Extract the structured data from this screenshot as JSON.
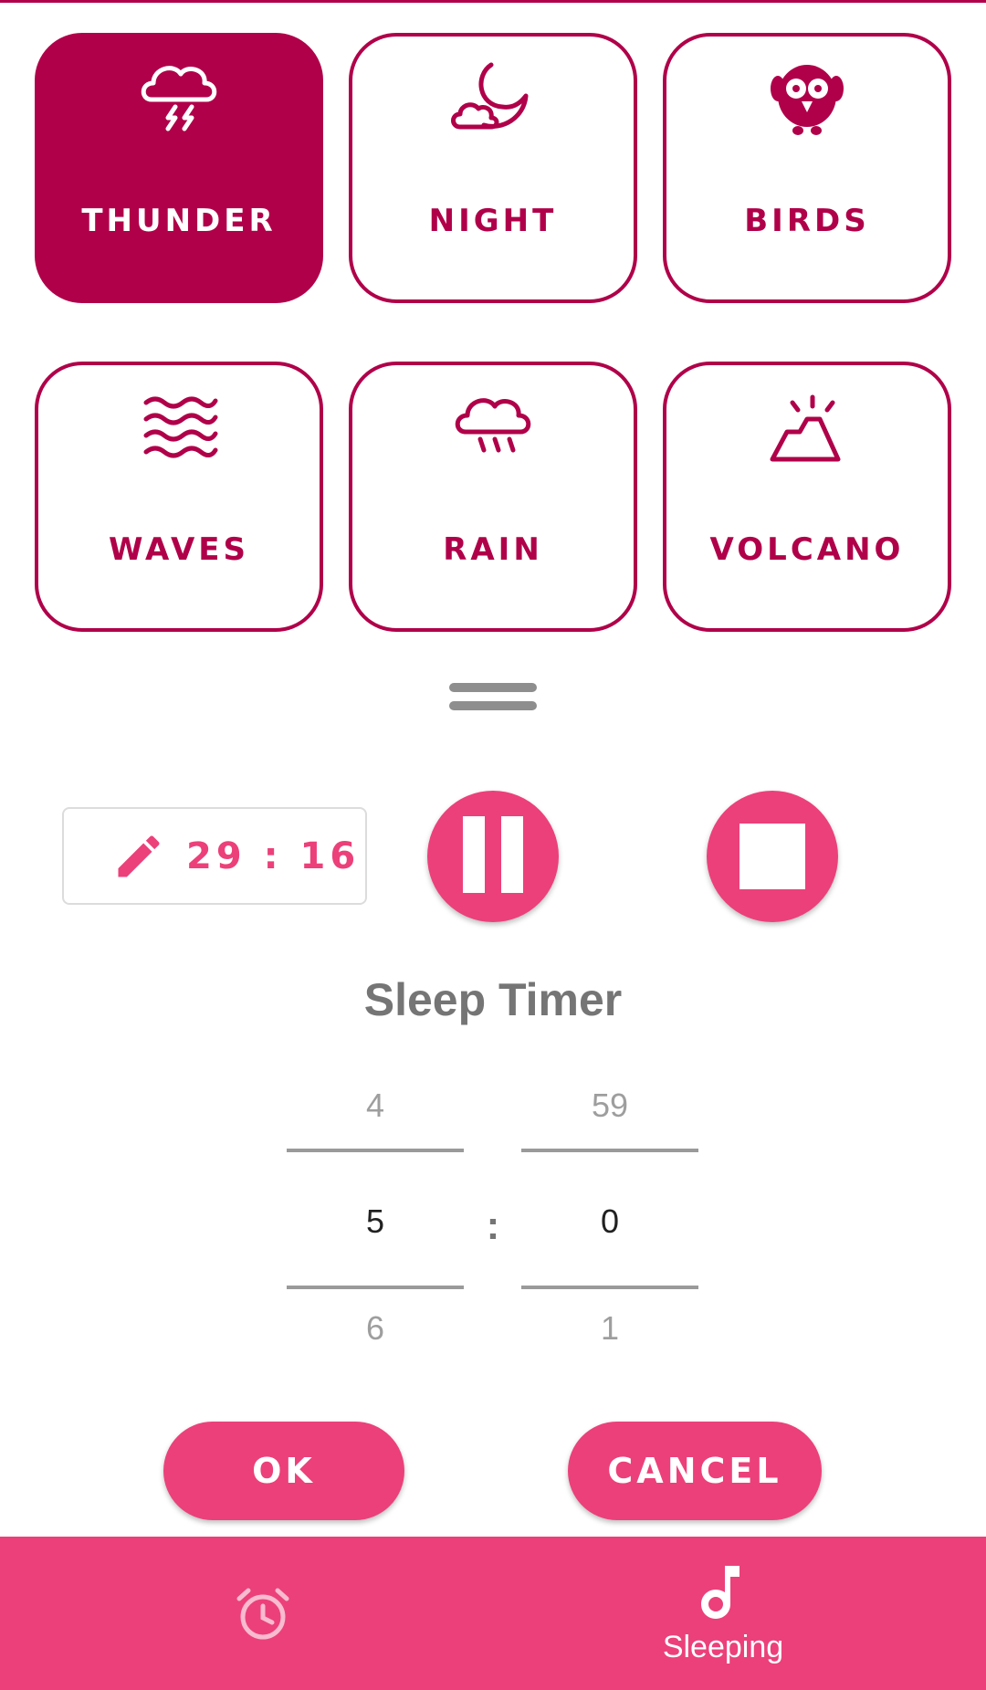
{
  "sounds": [
    {
      "label": "THUNDER",
      "icon": "thunderstorm-icon",
      "selected": true
    },
    {
      "label": "NIGHT",
      "icon": "moon-cloud-icon",
      "selected": false
    },
    {
      "label": "BIRDS",
      "icon": "bird-icon",
      "selected": false
    },
    {
      "label": "WAVES",
      "icon": "waves-icon",
      "selected": false
    },
    {
      "label": "RAIN",
      "icon": "rain-cloud-icon",
      "selected": false
    },
    {
      "label": "VOLCANO",
      "icon": "volcano-icon",
      "selected": false
    }
  ],
  "player": {
    "remaining": "29 : 16",
    "edit_icon": "pencil-icon",
    "pause_icon": "pause-icon",
    "stop_icon": "stop-icon"
  },
  "sleep_timer": {
    "title": "Sleep Timer",
    "hours": {
      "prev": "4",
      "current": "5",
      "next": "6"
    },
    "separator": ":",
    "minutes": {
      "prev": "59",
      "current": "0",
      "next": "1"
    },
    "ok_label": "OK",
    "cancel_label": "CANCEL"
  },
  "bottom_nav": {
    "alarm_icon": "alarm-clock-icon",
    "sleeping_icon": "music-note-icon",
    "sleeping_label": "Sleeping"
  },
  "colors": {
    "accent_dark": "#b00049",
    "accent": "#ec407a",
    "text_gray": "#757575"
  }
}
